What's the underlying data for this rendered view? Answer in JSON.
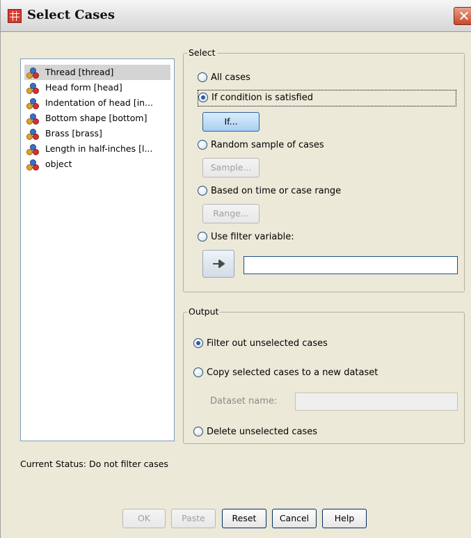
{
  "window": {
    "title": "Select Cases",
    "close_glyph": "✕",
    "app_icon": "spss-grid-icon"
  },
  "variables": [
    {
      "label": "Thread [thread]",
      "icon": "nominal-variable-icon",
      "selected": true
    },
    {
      "label": "Head form [head]",
      "icon": "nominal-variable-icon",
      "selected": false
    },
    {
      "label": "Indentation of head [in...",
      "icon": "nominal-variable-icon",
      "selected": false
    },
    {
      "label": "Bottom shape [bottom]",
      "icon": "nominal-variable-icon",
      "selected": false
    },
    {
      "label": "Brass [brass]",
      "icon": "nominal-variable-icon",
      "selected": false
    },
    {
      "label": "Length in half-inches [l...",
      "icon": "nominal-variable-icon",
      "selected": false
    },
    {
      "label": "object",
      "icon": "nominal-variable-icon",
      "selected": false
    }
  ],
  "select": {
    "title": "Select",
    "all_cases": "All cases",
    "if_condition": "If condition is satisfied",
    "if_button": "If...",
    "random_sample": "Random sample of cases",
    "sample_button": "Sample...",
    "time_range": "Based on time or case range",
    "range_button": "Range...",
    "filter_var": "Use filter variable:",
    "filter_value": "",
    "move_icon": "arrow-right-icon",
    "selected_option": "If condition is satisfied"
  },
  "output": {
    "title": "Output",
    "filter_out": "Filter out unselected cases",
    "copy_cases": "Copy selected cases to a new dataset",
    "dataset_name_label": "Dataset name:",
    "dataset_name_value": "",
    "delete_cases": "Delete unselected cases",
    "selected_option": "Filter out unselected cases"
  },
  "status": {
    "text": "Current Status: Do not filter cases"
  },
  "buttons": {
    "ok": "OK",
    "paste": "Paste",
    "reset": "Reset",
    "cancel": "Cancel",
    "help": "Help"
  },
  "colors": {
    "dialog_bg": "#ece9d8",
    "list_selection": "#d4d4d4",
    "primary_button": "#a9d0f2",
    "close_button": "#c8482c"
  }
}
